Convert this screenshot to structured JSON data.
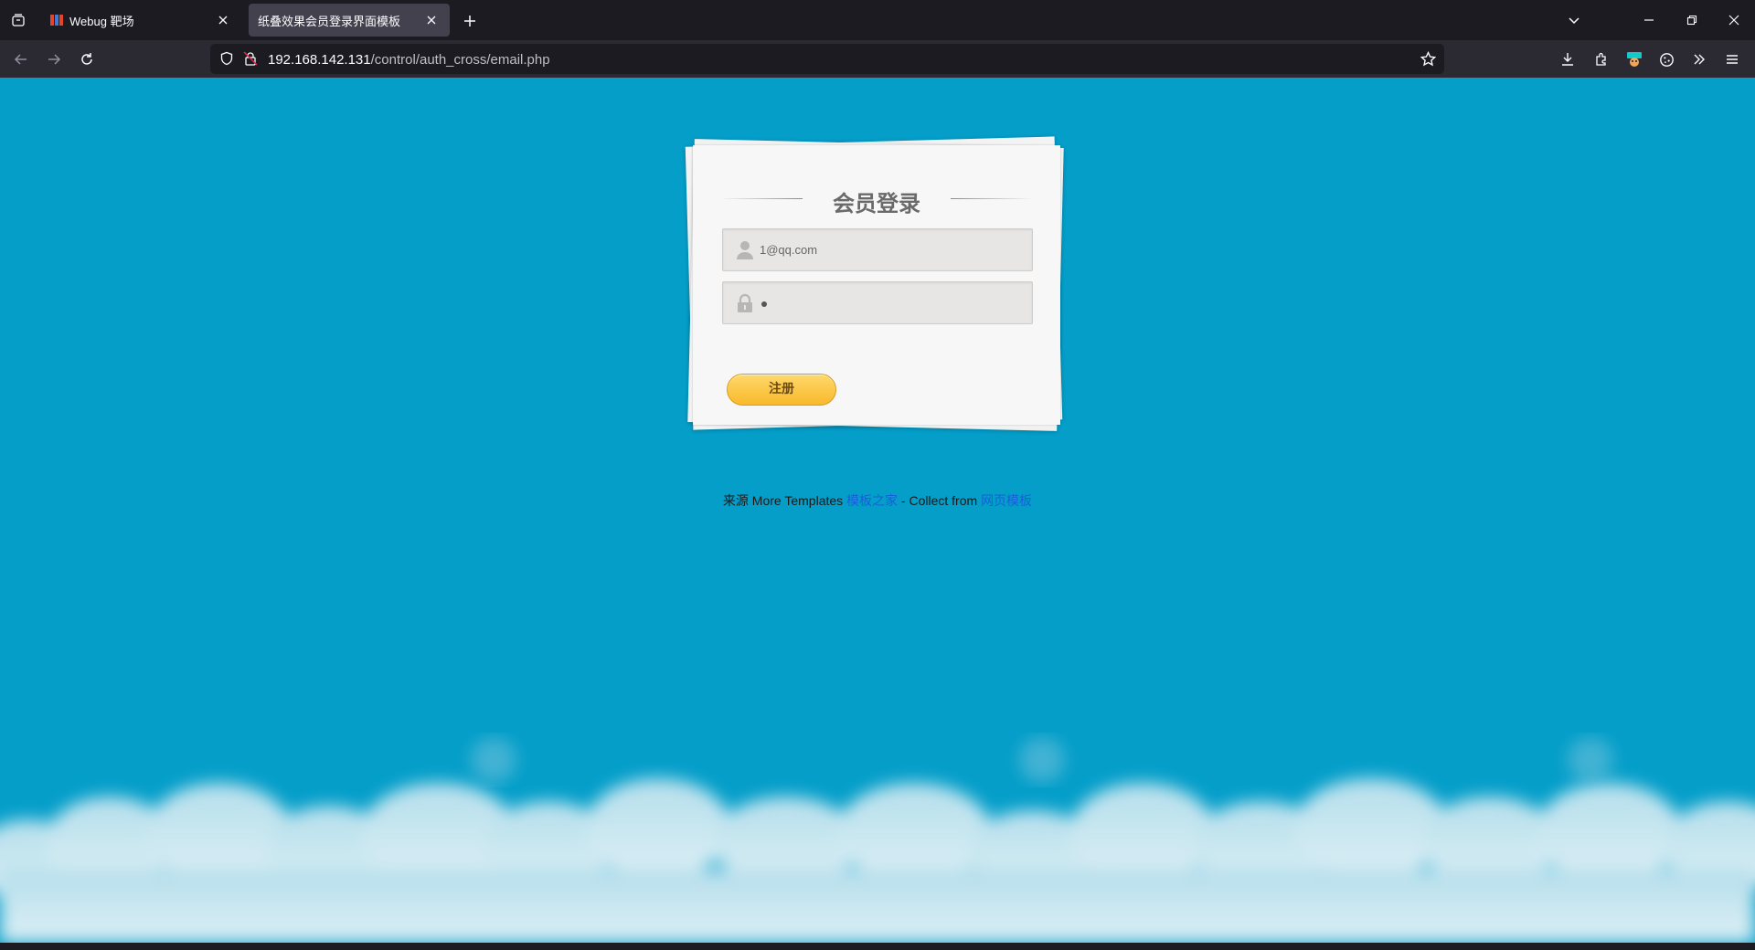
{
  "browser": {
    "tabs": [
      {
        "title": "Webug 靶场",
        "active": false
      },
      {
        "title": "纸叠效果会员登录界面模板",
        "active": true
      }
    ],
    "url": {
      "host": "192.168.142.131",
      "path": "/control/auth_cross/email.php"
    }
  },
  "login": {
    "title": "会员登录",
    "email_value": "1@qq.com",
    "password_masked": "•",
    "register_label": "注册"
  },
  "footer": {
    "prefix": "来源 More Templates ",
    "link1": "模板之家",
    "middle": " - Collect from ",
    "link2": "网页模板"
  },
  "colors": {
    "page_bg": "#049ec9",
    "button": "#f8b92c",
    "link": "#1560d8"
  }
}
